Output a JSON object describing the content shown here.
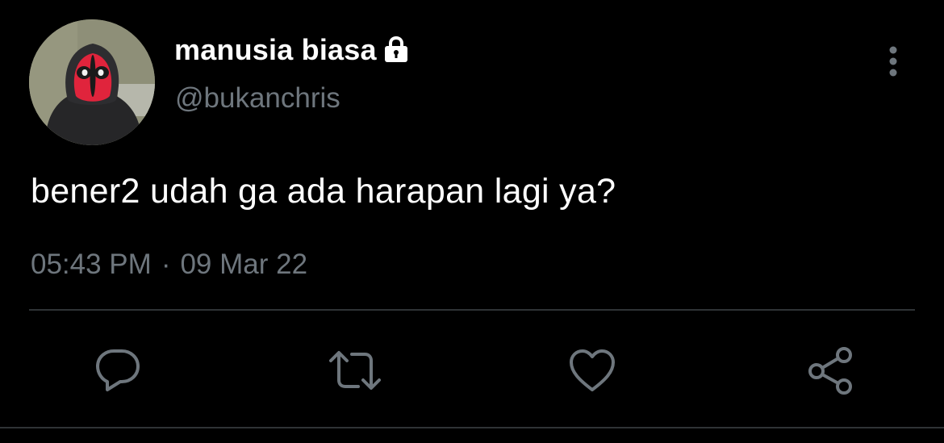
{
  "tweet": {
    "display_name": "manusia biasa",
    "handle": "@bukanchris",
    "text": "bener2 udah ga ada harapan lagi ya?",
    "time": "05:43 PM",
    "separator": "·",
    "date": "09 Mar 22",
    "protected": true
  },
  "icons": {
    "lock": "lock-icon",
    "more": "more-vertical-icon",
    "reply": "reply-icon",
    "retweet": "retweet-icon",
    "like": "heart-icon",
    "share": "share-icon"
  },
  "colors": {
    "background": "#000000",
    "primary_text": "#ffffff",
    "secondary_text": "#6e767d",
    "divider": "#2f3336",
    "icon": "#6e767d"
  }
}
